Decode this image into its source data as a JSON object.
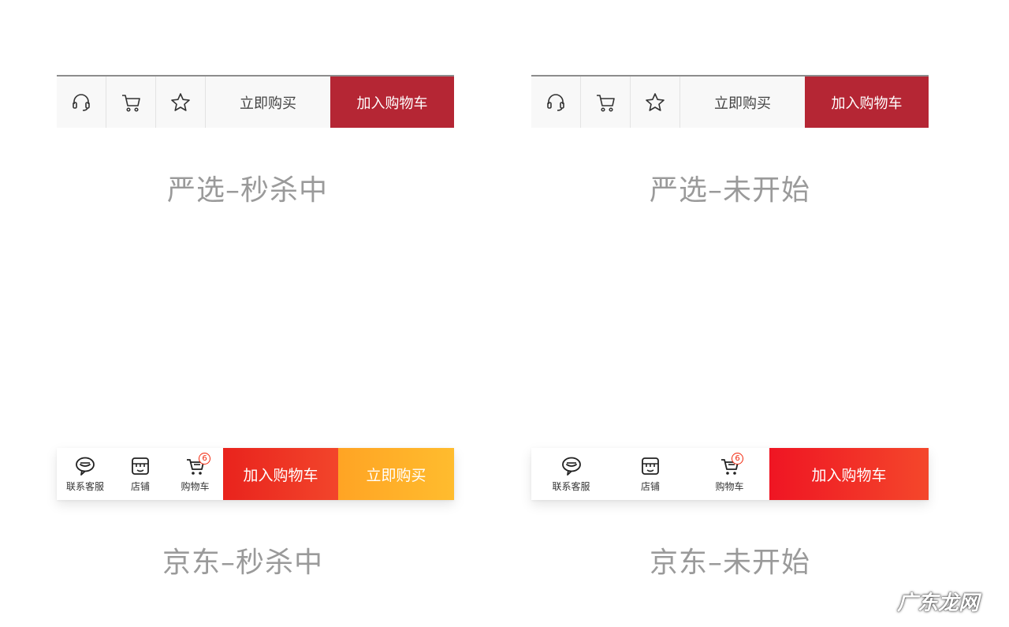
{
  "yanxuan_flash": {
    "buy_now": "立即购买",
    "add_to_cart": "加入购物车",
    "cart_color": "#b52634",
    "caption": "严选–秒杀中"
  },
  "yanxuan_upcoming": {
    "buy_now": "立即购买",
    "add_to_cart": "加入购物车",
    "cart_color": "#b52634",
    "caption": "严选–未开始"
  },
  "jd_flash": {
    "service_label": "联系客服",
    "store_label": "店铺",
    "cart_label": "购物车",
    "cart_badge": "6",
    "add_to_cart": "加入购物车",
    "buy_now": "立即购买",
    "add_to_cart_gradient": [
      "#e9231d",
      "#f2452b"
    ],
    "buy_now_gradient": [
      "#ffa424",
      "#ffbc2e"
    ],
    "caption": "京东–秒杀中"
  },
  "jd_upcoming": {
    "service_label": "联系客服",
    "store_label": "店铺",
    "cart_label": "购物车",
    "cart_badge": "6",
    "add_to_cart": "加入购物车",
    "add_to_cart_gradient": [
      "#ef1523",
      "#f4472b"
    ],
    "caption": "京东–未开始"
  },
  "watermark": "广东龙网"
}
